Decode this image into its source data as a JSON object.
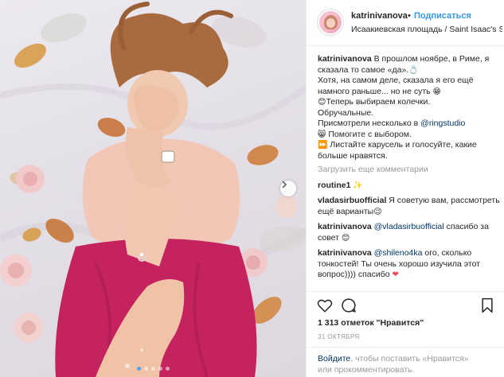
{
  "header": {
    "username": "katrinivanova",
    "separator": "•",
    "follow_label": "Подписаться",
    "location": "Исаакиевская площадь / Saint Isaac's Sq..."
  },
  "caption": {
    "username": "katrinivanova",
    "lines": [
      "В прошлом ноябре, в Риме, я сказала то самое «да».",
      "Хотя, на самом деле, сказала я его ещё намного раньше... но не суть",
      "Теперь выбираем колечки.",
      "Обручальные.",
      "Присмотрели несколько в",
      "Помогите с выбором.",
      "Листайте карусель и голосуйте, какие больше нравятся."
    ],
    "mention": "@ringstudio",
    "emojis": {
      "ring": "💍",
      "grin": "😁",
      "smile": "😊",
      "cat": "😸",
      "arrows": "⏩"
    }
  },
  "load_more": "Загрузить еще комментарии",
  "comments": [
    {
      "user": "routine1",
      "text": "",
      "emoji": "✨"
    },
    {
      "user": "vladasirbuofficial",
      "text": "Я советую вам, рассмотреть ещё варианты",
      "emoji": "😉"
    },
    {
      "user": "katrinivanova",
      "mention": "@vladasirbuofficial",
      "text": "спасибо за совет",
      "emoji": "😊"
    },
    {
      "user": "katrinivanova",
      "mention": "@shileno4ka",
      "text": "ого, сколько тонкостей! Ты очень хорошо изучила этот вопрос)))) спасибо",
      "emoji": "❤"
    }
  ],
  "likes": "1 313 отметок \"Нравится\"",
  "date": "31 ОКТЯБРЯ",
  "footer": {
    "login_link": "Войдите",
    "text_middle": ", чтобы поставить «Нравится»",
    "text_end": "или прокомментировать."
  },
  "carousel": {
    "count": 5,
    "active_index": 0
  },
  "colors": {
    "accent": "#3897f0",
    "mention": "#003569",
    "muted": "#999999",
    "heart": "#ed4956"
  },
  "icons": [
    "heart-icon",
    "comment-icon",
    "bookmark-icon",
    "chevron-right-icon"
  ]
}
